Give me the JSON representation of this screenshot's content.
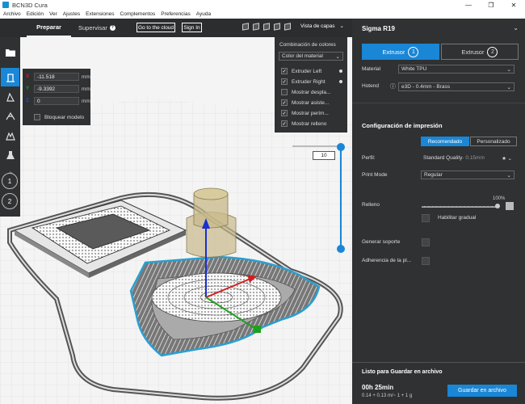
{
  "window": {
    "title": "BCN3D Cura"
  },
  "menu": [
    "Archivo",
    "Edición",
    "Ver",
    "Ajustes",
    "Extensiones",
    "Complementos",
    "Preferencias",
    "Ayuda"
  ],
  "stages": {
    "prepare": "Preparar",
    "monitor": "Supervisar"
  },
  "top_buttons": {
    "cloud": "Go to the cloud",
    "signin": "Sign In"
  },
  "view_mode": "Vista de capas",
  "move_panel": {
    "x": "-11.518",
    "y": "-9.3392",
    "z": "0",
    "axis_x": "X",
    "axis_y": "Y",
    "axis_z": "Z",
    "unit": "mm",
    "lock_label": "Bloquear modelo"
  },
  "color_panel": {
    "header": "Combinación de colores",
    "scheme": "Color del material",
    "options": [
      {
        "label": "Extruder Left",
        "checked": true
      },
      {
        "label": "Extruder Right",
        "checked": true
      },
      {
        "label": "Mostrar despla...",
        "checked": false
      },
      {
        "label": "Mostrar asiste...",
        "checked": true
      },
      {
        "label": "Mostrar perím...",
        "checked": true
      },
      {
        "label": "Mostrar relleno",
        "checked": true
      }
    ]
  },
  "layer_slider": {
    "current_layer": "10"
  },
  "extruder_buttons": [
    "1",
    "2"
  ],
  "printer": {
    "name": "Sigma R19",
    "extruder1_label": "Extrusor",
    "extruder1_num": "1",
    "extruder2_label": "Extrusor",
    "extruder2_num": "2",
    "material_label": "Material",
    "material_value": "White TPU",
    "hotend_label": "Hotend",
    "hotend_value": "e3D - 0.4mm - Brass"
  },
  "print_settings": {
    "title": "Configuración de impresión",
    "mode_recommended": "Recomendado",
    "mode_custom": "Personalizado",
    "profile_label": "Perfil:",
    "profile_value": "Standard Quality",
    "profile_layer": " - 0.15mm",
    "print_mode_label": "Print Mode",
    "print_mode_value": "Regular",
    "infill_label": "Relleno",
    "infill_percent": "100%",
    "infill_value": 1.0,
    "gradual_label": "Habilitar gradual",
    "support_label": "Generar soporte",
    "adhesion_label": "Adherencia de la pl..."
  },
  "output": {
    "ready": "Listo para Guardar en archivo",
    "time": "00h 25min",
    "material": "0.14 + 0.13 m/~ 1 + 1 g",
    "save_button": "Guardar en archivo"
  },
  "colors": {
    "accent": "#1a86d6",
    "panel": "#2f3133",
    "topbar": "#2b2d2f"
  }
}
